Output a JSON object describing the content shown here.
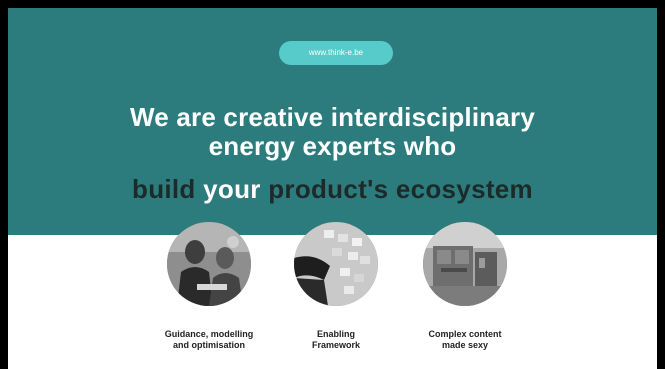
{
  "url_badge": "www.think-e.be",
  "headline": {
    "line1": "We are creative interdisciplinary",
    "line2": "energy experts who"
  },
  "tagline": {
    "part1": "build",
    "part2": "your",
    "part3": "product's ecosystem"
  },
  "services": [
    {
      "line1": "Guidance, modelling",
      "line2": "and optimisation",
      "image_icon": "people-meeting-photo"
    },
    {
      "line1": "Enabling",
      "line2": "Framework",
      "image_icon": "sticky-notes-wall-photo"
    },
    {
      "line1": "Complex content",
      "line2": "made sexy",
      "image_icon": "energy-installation-photo"
    }
  ],
  "colors": {
    "hero_background": "#2c7c7e",
    "url_pill": "#56cbc9",
    "tagline_dark": "#1d2a2a",
    "text_light": "#ffffff"
  }
}
